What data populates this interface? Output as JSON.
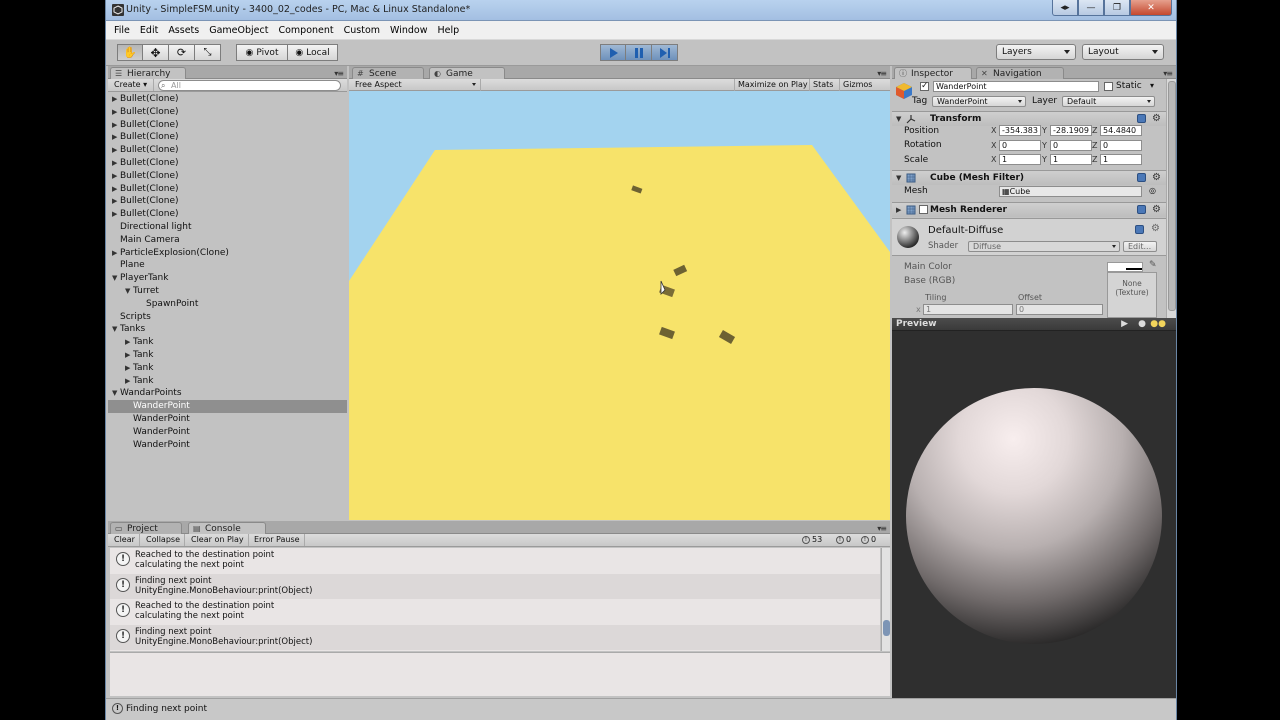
{
  "window": {
    "title": "Unity - SimpleFSM.unity - 3400_02_codes - PC, Mac & Linux Standalone*",
    "buttons": [
      "◂▸",
      "—",
      "❐",
      "✕"
    ]
  },
  "menu": [
    "File",
    "Edit",
    "Assets",
    "GameObject",
    "Component",
    "Custom",
    "Window",
    "Help"
  ],
  "toolbar": {
    "pivot": "Pivot",
    "local": "Local",
    "layers": "Layers",
    "layout": "Layout"
  },
  "hierarchy": {
    "tab": "Hierarchy",
    "create": "Create",
    "search_placeholder": "All",
    "items": [
      {
        "label": "Bullet(Clone)",
        "indent": 0,
        "arrow": "▶",
        "selected": false
      },
      {
        "label": "Bullet(Clone)",
        "indent": 0,
        "arrow": "▶",
        "selected": false
      },
      {
        "label": "Bullet(Clone)",
        "indent": 0,
        "arrow": "▶",
        "selected": false
      },
      {
        "label": "Bullet(Clone)",
        "indent": 0,
        "arrow": "▶",
        "selected": false
      },
      {
        "label": "Bullet(Clone)",
        "indent": 0,
        "arrow": "▶",
        "selected": false
      },
      {
        "label": "Bullet(Clone)",
        "indent": 0,
        "arrow": "▶",
        "selected": false
      },
      {
        "label": "Bullet(Clone)",
        "indent": 0,
        "arrow": "▶",
        "selected": false
      },
      {
        "label": "Bullet(Clone)",
        "indent": 0,
        "arrow": "▶",
        "selected": false
      },
      {
        "label": "Bullet(Clone)",
        "indent": 0,
        "arrow": "▶",
        "selected": false
      },
      {
        "label": "Bullet(Clone)",
        "indent": 0,
        "arrow": "▶",
        "selected": false
      },
      {
        "label": "Directional light",
        "indent": 0,
        "arrow": "",
        "selected": false
      },
      {
        "label": "Main Camera",
        "indent": 0,
        "arrow": "",
        "selected": false
      },
      {
        "label": "ParticleExplosion(Clone)",
        "indent": 0,
        "arrow": "▶",
        "selected": false
      },
      {
        "label": "Plane",
        "indent": 0,
        "arrow": "",
        "selected": false
      },
      {
        "label": "PlayerTank",
        "indent": 0,
        "arrow": "▼",
        "selected": false
      },
      {
        "label": "Turret",
        "indent": 1,
        "arrow": "▼",
        "selected": false
      },
      {
        "label": "SpawnPoint",
        "indent": 2,
        "arrow": "",
        "selected": false
      },
      {
        "label": "Scripts",
        "indent": 0,
        "arrow": "",
        "selected": false
      },
      {
        "label": "Tanks",
        "indent": 0,
        "arrow": "▼",
        "selected": false
      },
      {
        "label": "Tank",
        "indent": 1,
        "arrow": "▶",
        "selected": false
      },
      {
        "label": "Tank",
        "indent": 1,
        "arrow": "▶",
        "selected": false
      },
      {
        "label": "Tank",
        "indent": 1,
        "arrow": "▶",
        "selected": false
      },
      {
        "label": "Tank",
        "indent": 1,
        "arrow": "▶",
        "selected": false
      },
      {
        "label": "WandarPoints",
        "indent": 0,
        "arrow": "▼",
        "selected": false
      },
      {
        "label": "WanderPoint",
        "indent": 1,
        "arrow": "",
        "selected": true
      },
      {
        "label": "WanderPoint",
        "indent": 1,
        "arrow": "",
        "selected": false
      },
      {
        "label": "WanderPoint",
        "indent": 1,
        "arrow": "",
        "selected": false
      },
      {
        "label": "WanderPoint",
        "indent": 1,
        "arrow": "",
        "selected": false
      }
    ]
  },
  "game": {
    "tabs": [
      "Scene",
      "Game"
    ],
    "aspect": "Free Aspect",
    "buttons": [
      "Maximize on Play",
      "Stats",
      "Gizmos"
    ],
    "colors": {
      "sky": "#a3d3ef",
      "ground": "#f7e36a"
    }
  },
  "console": {
    "tabs": [
      "Project",
      "Console"
    ],
    "buttons": [
      "Clear",
      "Collapse",
      "Clear on Play",
      "Error Pause"
    ],
    "counts": {
      "logs": "53",
      "warnings": "0",
      "errors": "0"
    },
    "entries": [
      {
        "line1": "Reached to the destination point",
        "line2": "calculating the next point"
      },
      {
        "line1": "Finding next point",
        "line2": "UnityEngine.MonoBehaviour:print(Object)"
      },
      {
        "line1": "Reached to the destination point",
        "line2": "calculating the next point"
      },
      {
        "line1": "Finding next point",
        "line2": "UnityEngine.MonoBehaviour:print(Object)"
      }
    ]
  },
  "status": {
    "text": "Finding next point"
  },
  "inspector": {
    "tabs": [
      "Inspector",
      "Navigation"
    ],
    "object_name": "WanderPoint",
    "static_label": "Static",
    "tag_label": "Tag",
    "tag_value": "WanderPoint",
    "layer_label": "Layer",
    "layer_value": "Default",
    "transform": {
      "title": "Transform",
      "position_label": "Position",
      "rotation_label": "Rotation",
      "scale_label": "Scale",
      "position": [
        "-354.383",
        "-28.1909",
        "54.4840"
      ],
      "rotation": [
        "0",
        "0",
        "0"
      ],
      "scale": [
        "1",
        "1",
        "1"
      ]
    },
    "mesh_filter": {
      "title": "Cube (Mesh Filter)",
      "mesh_label": "Mesh",
      "mesh_value": "Cube"
    },
    "mesh_renderer": {
      "title": "Mesh Renderer"
    },
    "material": {
      "name": "Default-Diffuse",
      "shader_label": "Shader",
      "shader_value": "Diffuse",
      "edit_label": "Edit...",
      "main_color_label": "Main Color",
      "base_label": "Base (RGB)",
      "tiling_label": "Tiling",
      "offset_label": "Offset",
      "tiling_x": "1",
      "offset_x": "0",
      "texture_label": "None\n(Texture)"
    }
  },
  "preview": {
    "title": "Preview"
  }
}
